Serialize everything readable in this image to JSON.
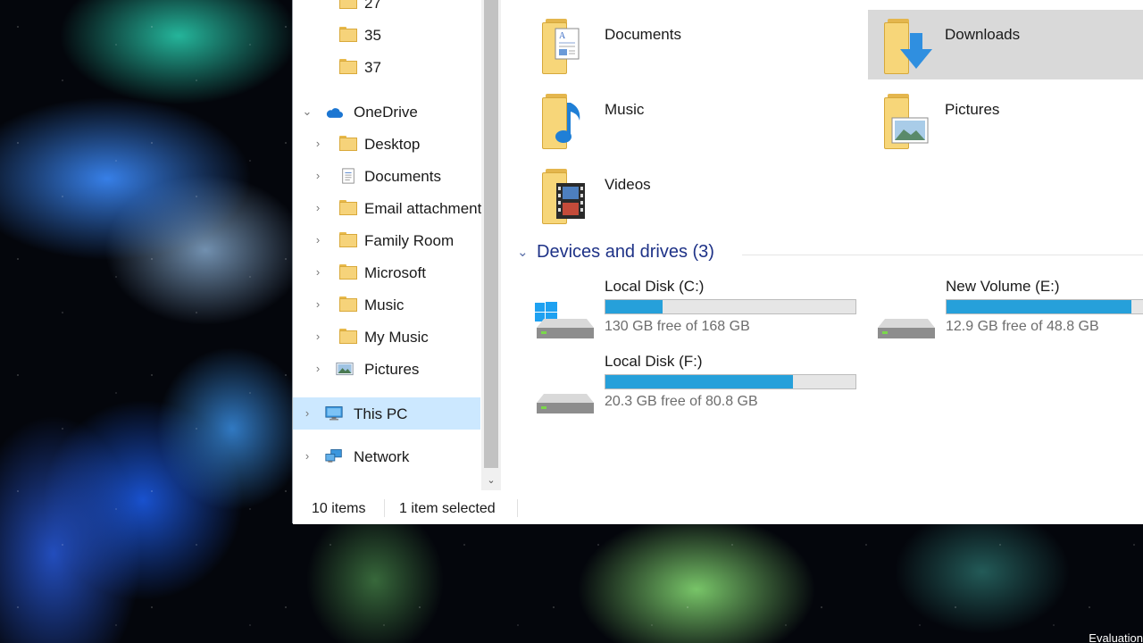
{
  "desktop": {
    "watermark": "Evaluation"
  },
  "nav": {
    "items": [
      {
        "label": "27"
      },
      {
        "label": "35"
      },
      {
        "label": "37"
      },
      {
        "label": "OneDrive"
      },
      {
        "label": "Desktop"
      },
      {
        "label": "Documents"
      },
      {
        "label": "Email attachments"
      },
      {
        "label": "Family Room"
      },
      {
        "label": "Microsoft"
      },
      {
        "label": "Music"
      },
      {
        "label": "My Music"
      },
      {
        "label": "Pictures"
      },
      {
        "label": "This PC"
      },
      {
        "label": "Network"
      }
    ]
  },
  "folders": [
    {
      "label": "Documents"
    },
    {
      "label": "Downloads"
    },
    {
      "label": "Music"
    },
    {
      "label": "Pictures"
    },
    {
      "label": "Videos"
    }
  ],
  "devices": {
    "title": "Devices and drives (3)",
    "drives": [
      {
        "name": "Local Disk (C:)",
        "free": "130 GB free of 168 GB",
        "used_fraction": 0.23
      },
      {
        "name": "New Volume (E:)",
        "free": "12.9 GB free of 48.8 GB",
        "used_fraction": 0.74
      },
      {
        "name": "Local Disk (F:)",
        "free": "20.3 GB free of 80.8 GB",
        "used_fraction": 0.75
      }
    ]
  },
  "status": {
    "count": "10 items",
    "selected": "1 item selected"
  },
  "colors": {
    "accent": "#26a0da",
    "selection": "#cce8ff",
    "section_title": "#1e3287"
  }
}
